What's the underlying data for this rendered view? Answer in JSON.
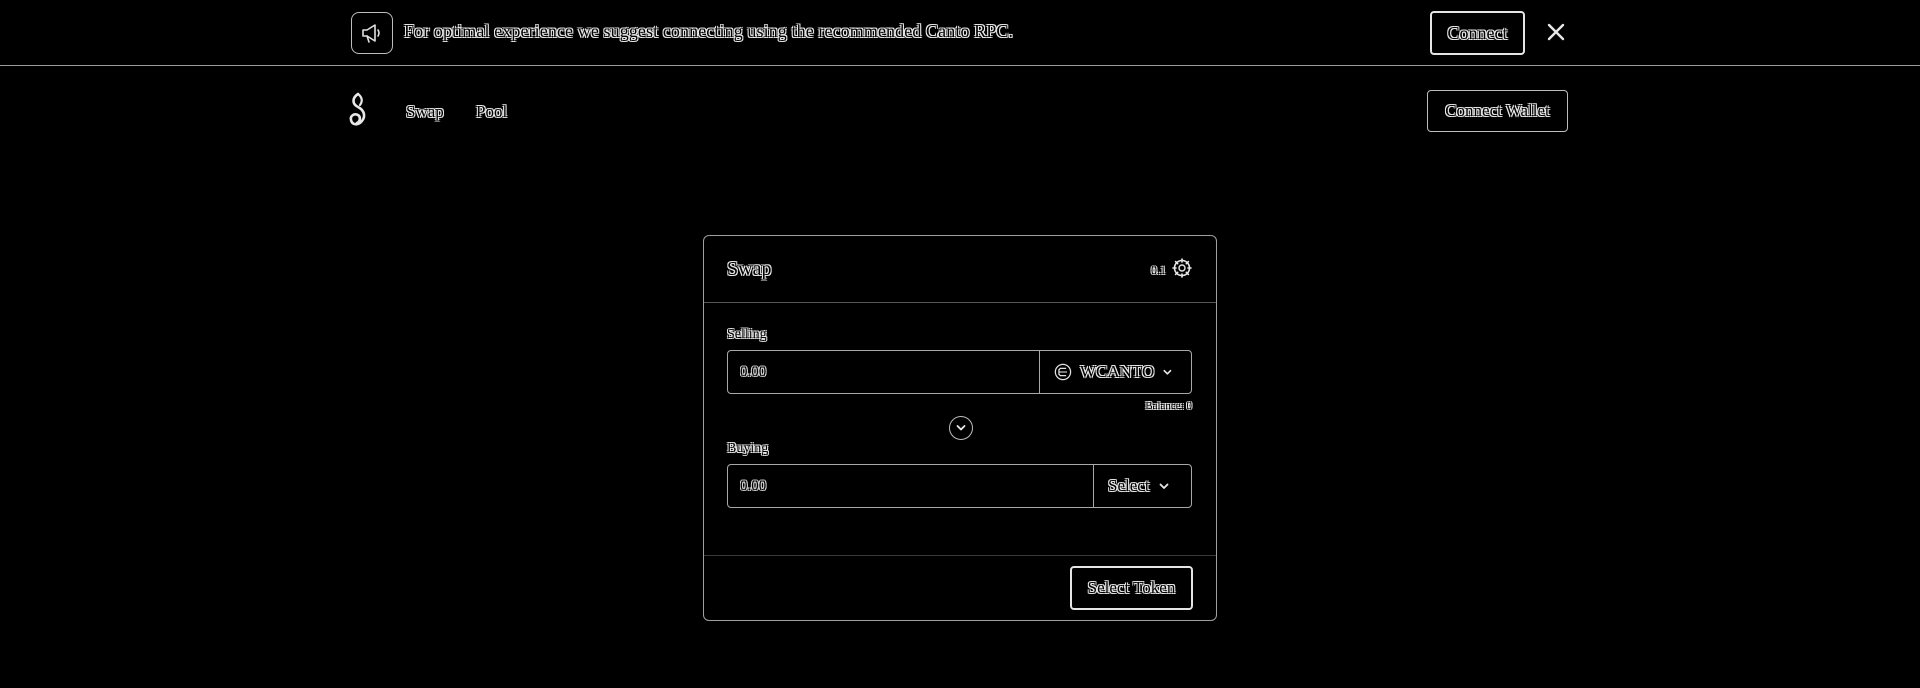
{
  "banner": {
    "message": "For optimal experience we suggest connecting using the recommended Canto RPC.",
    "connect_label": "Connect",
    "icon": "megaphone-icon",
    "close_icon": "close-icon"
  },
  "nav": {
    "logo": "canto-logo-icon",
    "links": [
      "Swap",
      "Pool"
    ],
    "connect_wallet_label": "Connect Wallet"
  },
  "swap_card": {
    "title": "Swap",
    "slippage": "0.1",
    "settings_icon": "gear-icon",
    "selling": {
      "label": "Selling",
      "placeholder": "0.00",
      "token": "WCANTO",
      "balance": "Balance: 0"
    },
    "buying": {
      "label": "Buying",
      "placeholder": "0.00",
      "token": "Select"
    },
    "action_label": "Select Token"
  },
  "colors": {
    "background": "#000000",
    "outline": "#e8e8e8",
    "border": "#a8a8a8"
  }
}
